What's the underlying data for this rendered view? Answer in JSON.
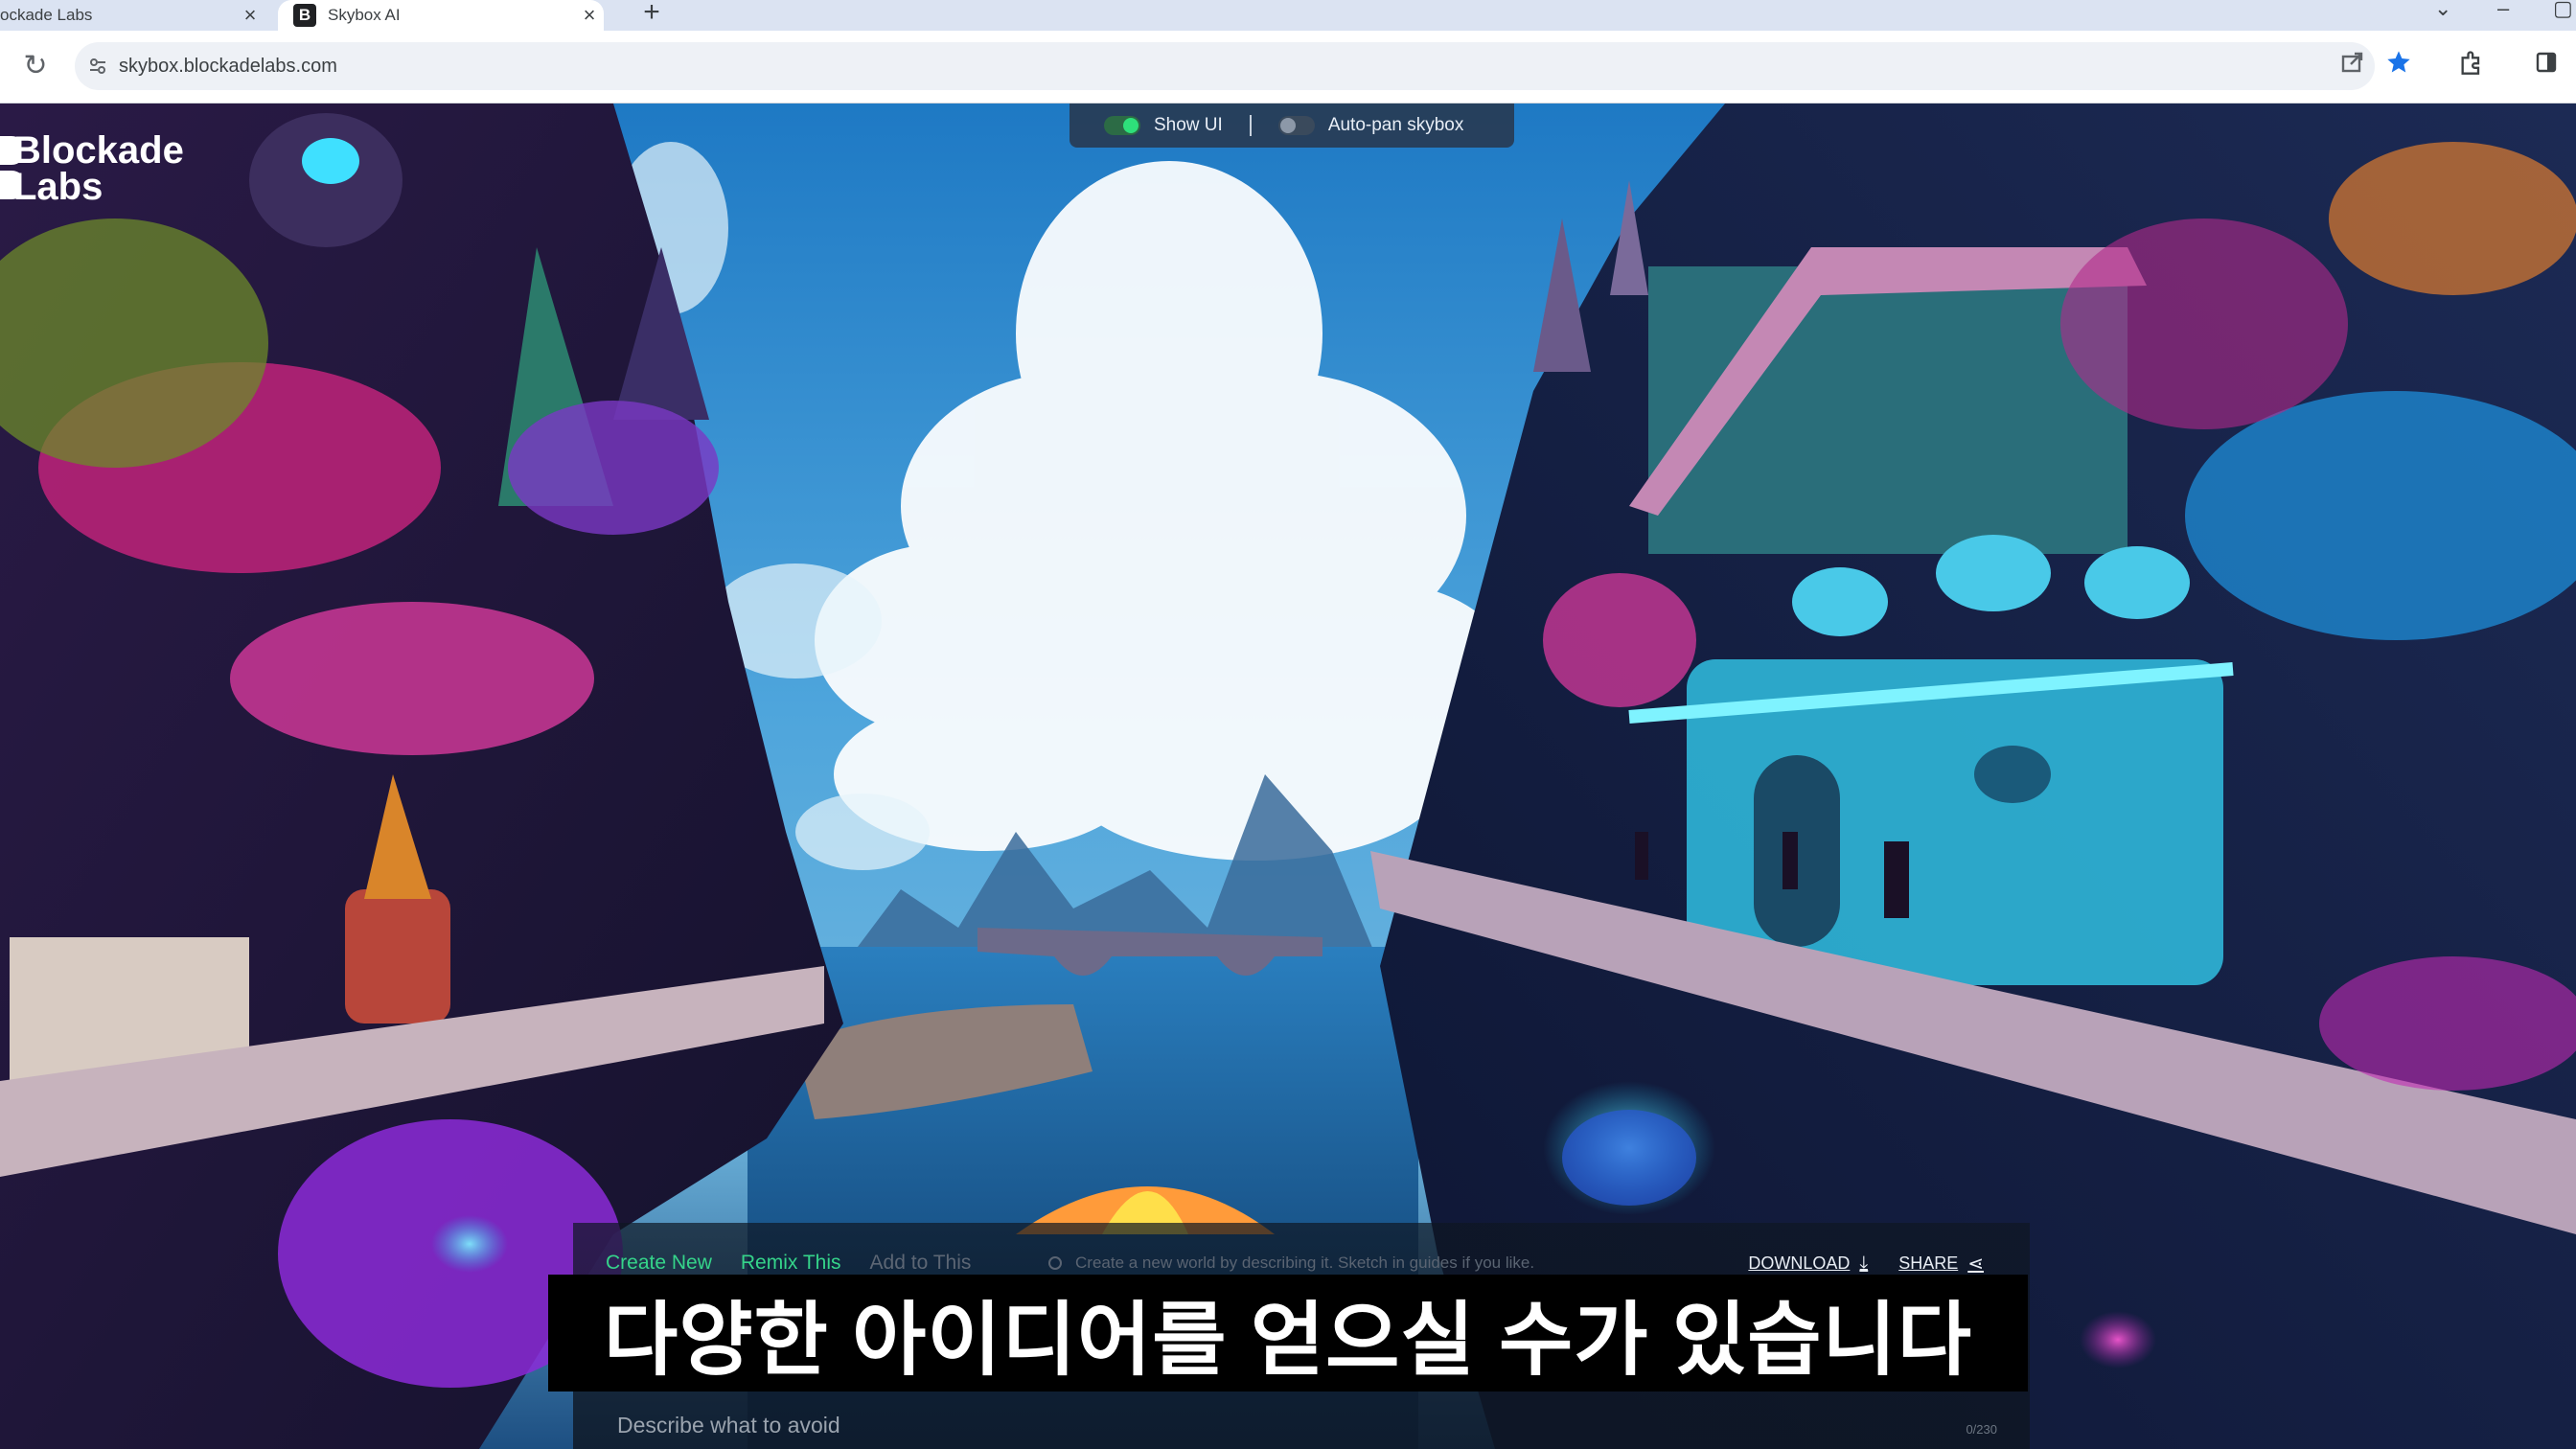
{
  "browser": {
    "tabs": [
      {
        "title": "ockade Labs",
        "close": "×"
      },
      {
        "favicon": "B",
        "title": "Skybox AI",
        "close": "×"
      }
    ],
    "new_tab": "+",
    "address_bar": {
      "url": "skybox.blockadelabs.com"
    },
    "icons": [
      "reload-icon",
      "site-info-icon",
      "share-icon",
      "bookmark-star-icon",
      "extensions-icon",
      "side-panel-icon"
    ],
    "accent_color": "#1a73e8"
  },
  "app": {
    "brand": {
      "line1": "Blockade",
      "line2": "Labs"
    },
    "toggles": [
      {
        "label": "Show UI",
        "state": "on"
      },
      {
        "label": "Auto-pan skybox",
        "state": "off"
      }
    ],
    "panel": {
      "tabs": [
        "Create New",
        "Remix This",
        "Add to This"
      ],
      "prompt_hint": "Create a new world by describing it. Sketch in guides if you like.",
      "download_label": "DOWNLOAD",
      "share_label": "SHARE",
      "negative_placeholder": "Describe what to avoid",
      "counter": "0/230"
    }
  },
  "caption": "다양한 아이디어를 얻으실 수가 있습니다",
  "colors": {
    "active_tab": "#35d48a",
    "toggle_on": "#2ee07a"
  }
}
